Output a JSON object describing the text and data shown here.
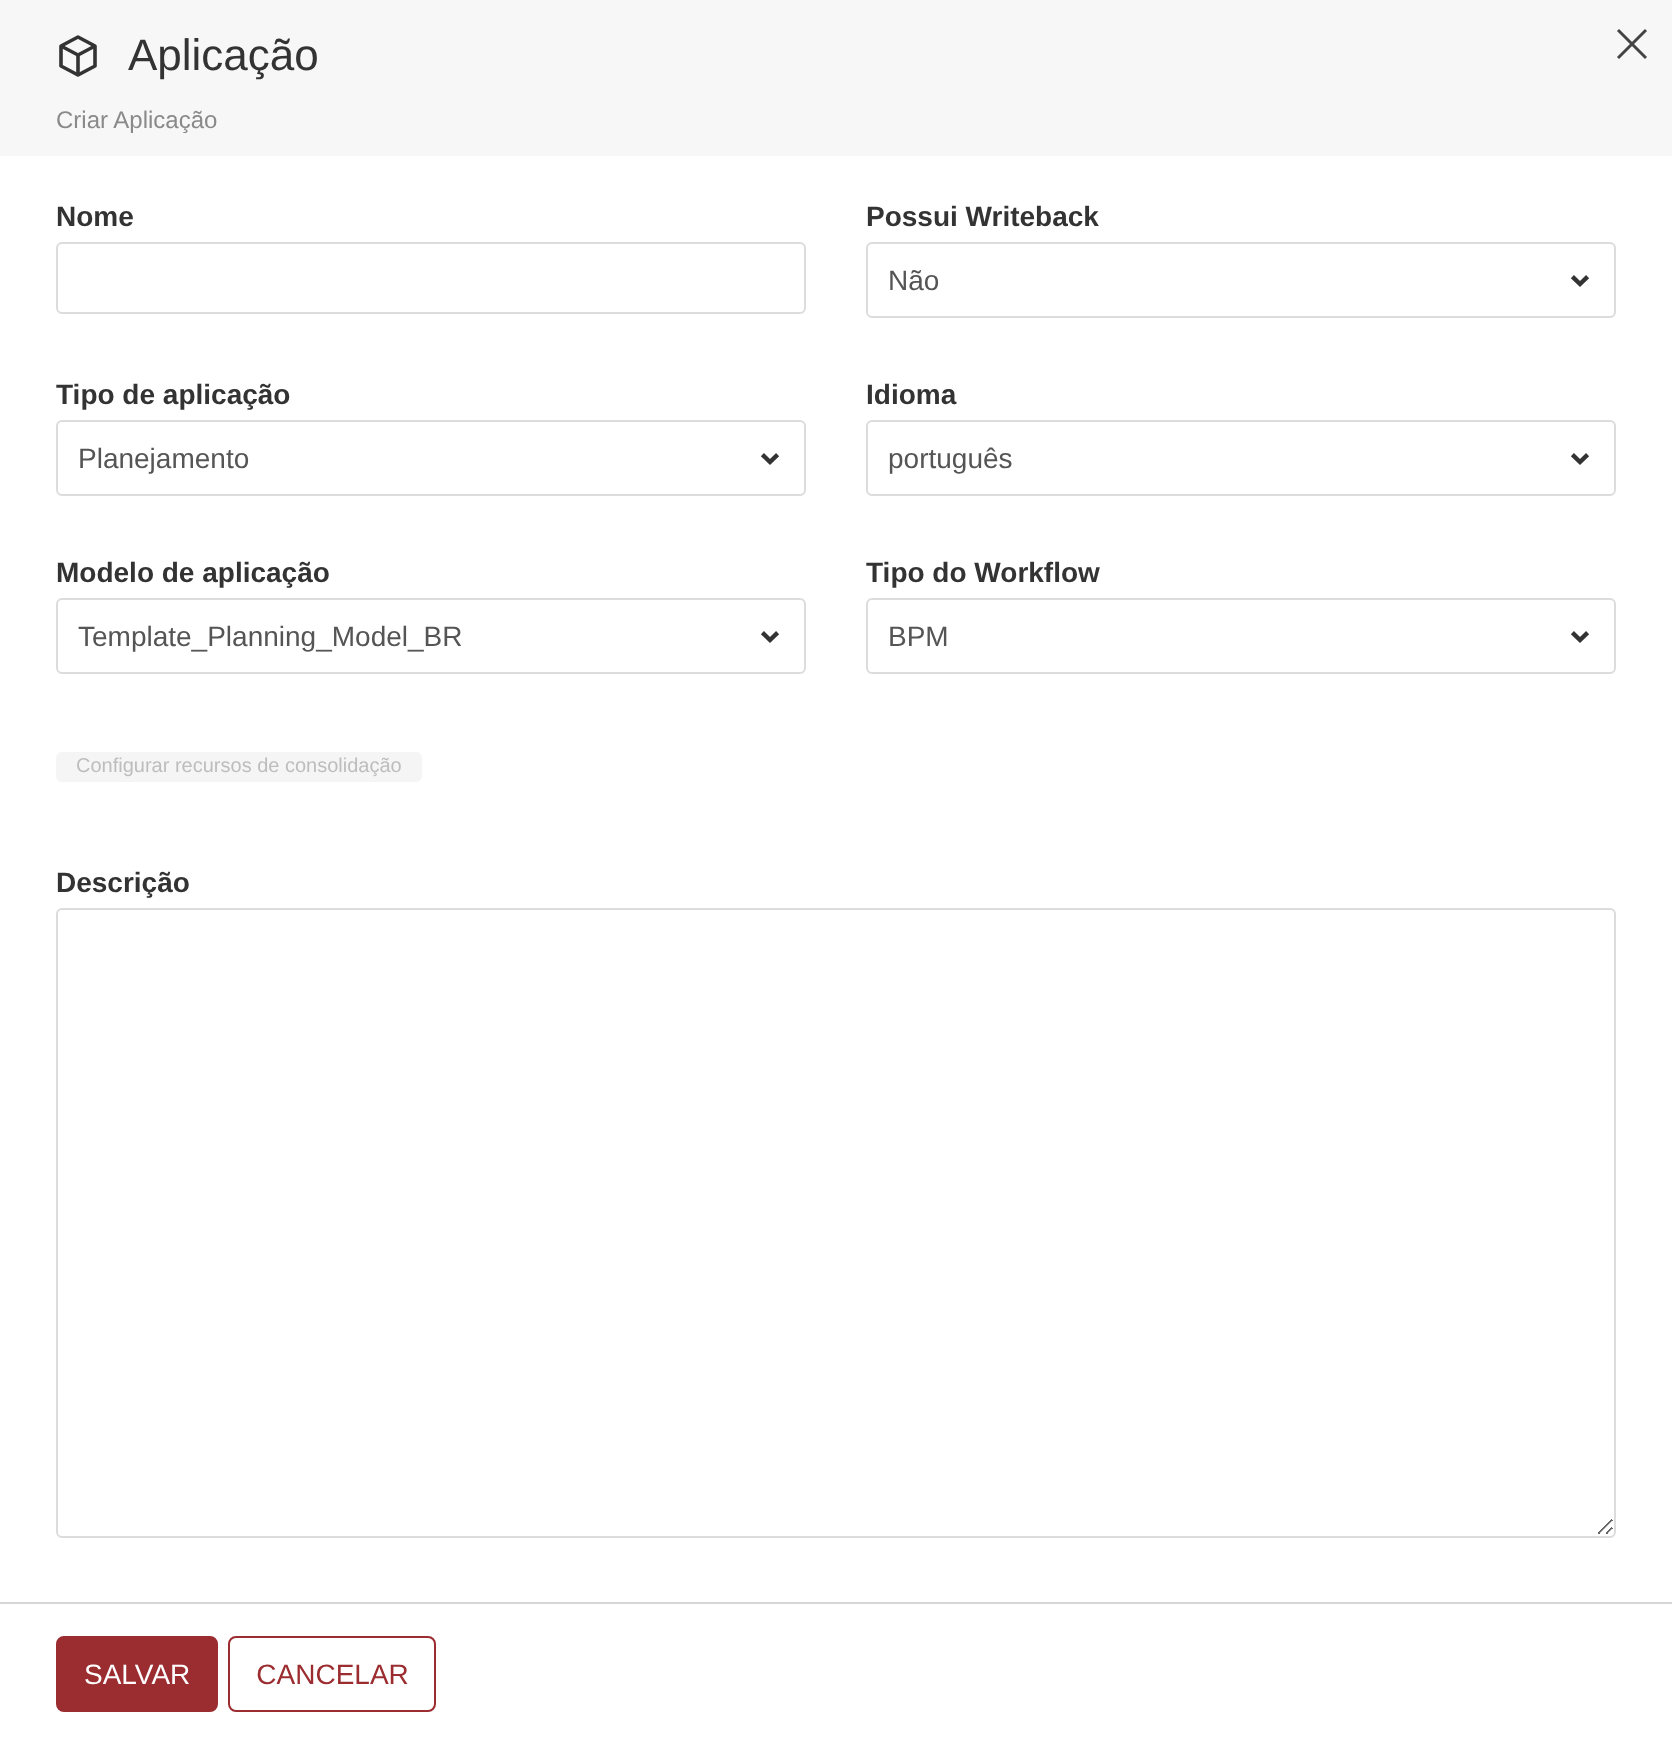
{
  "header": {
    "title": "Aplicação",
    "subtitle": "Criar Aplicação"
  },
  "fields": [
    {
      "label": "Nome",
      "kind": "text"
    },
    {
      "label": "Possui Writeback",
      "kind": "select",
      "value": "Não"
    },
    {
      "label": "Tipo de aplicação",
      "kind": "select",
      "value": "Planejamento"
    },
    {
      "label": "Idioma",
      "kind": "select",
      "value": "português"
    },
    {
      "label": "Modelo de aplicação",
      "kind": "select",
      "value": "Template_Planning_Model_BR"
    },
    {
      "label": "Tipo do Workflow",
      "kind": "select",
      "value": "BPM"
    }
  ],
  "consolidation_button": {
    "label": "Configurar recursos de consolidação",
    "disabled": true
  },
  "description": {
    "label": "Descrição"
  },
  "buttons": [
    {
      "label": "SALVAR",
      "kind": "primary"
    },
    {
      "label": "CANCELAR",
      "kind": "secondary"
    }
  ]
}
